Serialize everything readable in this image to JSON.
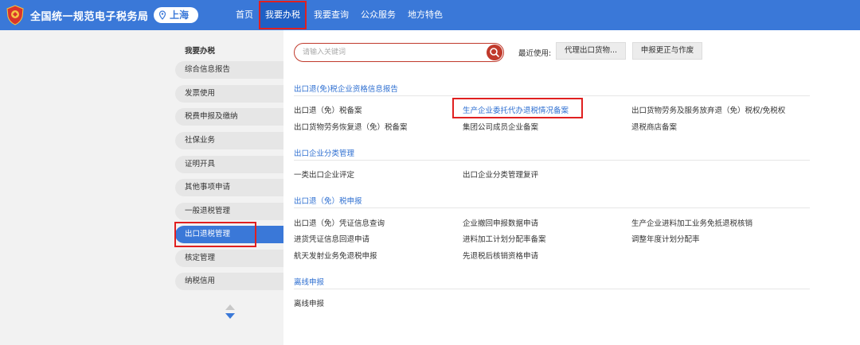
{
  "header": {
    "site_title": "全国统一规范电子税务局",
    "city": "上海",
    "nav": [
      "首页",
      "我要办税",
      "我要查询",
      "公众服务",
      "地方特色"
    ],
    "active_nav_index": 1
  },
  "sidebar": {
    "heading": "我要办税",
    "items": [
      "综合信息报告",
      "发票使用",
      "税费申报及缴纳",
      "社保业务",
      "证明开具",
      "其他事项申请",
      "一般退税管理",
      "出口退税管理",
      "核定管理",
      "纳税信用"
    ],
    "active_index": 7
  },
  "search": {
    "placeholder": "请输入关键词"
  },
  "recent": {
    "label": "最近使用:",
    "buttons": [
      "代理出口货物...",
      "申报更正与作废"
    ]
  },
  "sections": [
    {
      "title": "出口退(免)税企业资格信息报告",
      "links": [
        "出口退（免）税备案",
        "生产企业委托代办退税情况备案",
        "出口货物劳务及服务放弃退（免）税权/免税权",
        "出口货物劳务恢复退（免）税备案",
        "集团公司成员企业备案",
        "退税商店备案"
      ]
    },
    {
      "title": "出口企业分类管理",
      "links": [
        "一类出口企业评定",
        "出口企业分类管理复评"
      ]
    },
    {
      "title": "出口退（免）税申报",
      "links": [
        "出口退（免）凭证信息查询",
        "企业撤回申报数据申请",
        "生产企业进料加工业务免抵退税核销",
        "进货凭证信息回退申请",
        "进料加工计划分配率备案",
        "调整年度计划分配率",
        "航天发射业务免退税申报",
        "先退税后核销资格申请"
      ]
    },
    {
      "title": "离线申报",
      "links": [
        "离线申报"
      ]
    }
  ],
  "colors": {
    "header": "#3a78d8",
    "highlight": "#e02020",
    "link_blue": "#2e6fd1",
    "search_red": "#c0392b"
  }
}
